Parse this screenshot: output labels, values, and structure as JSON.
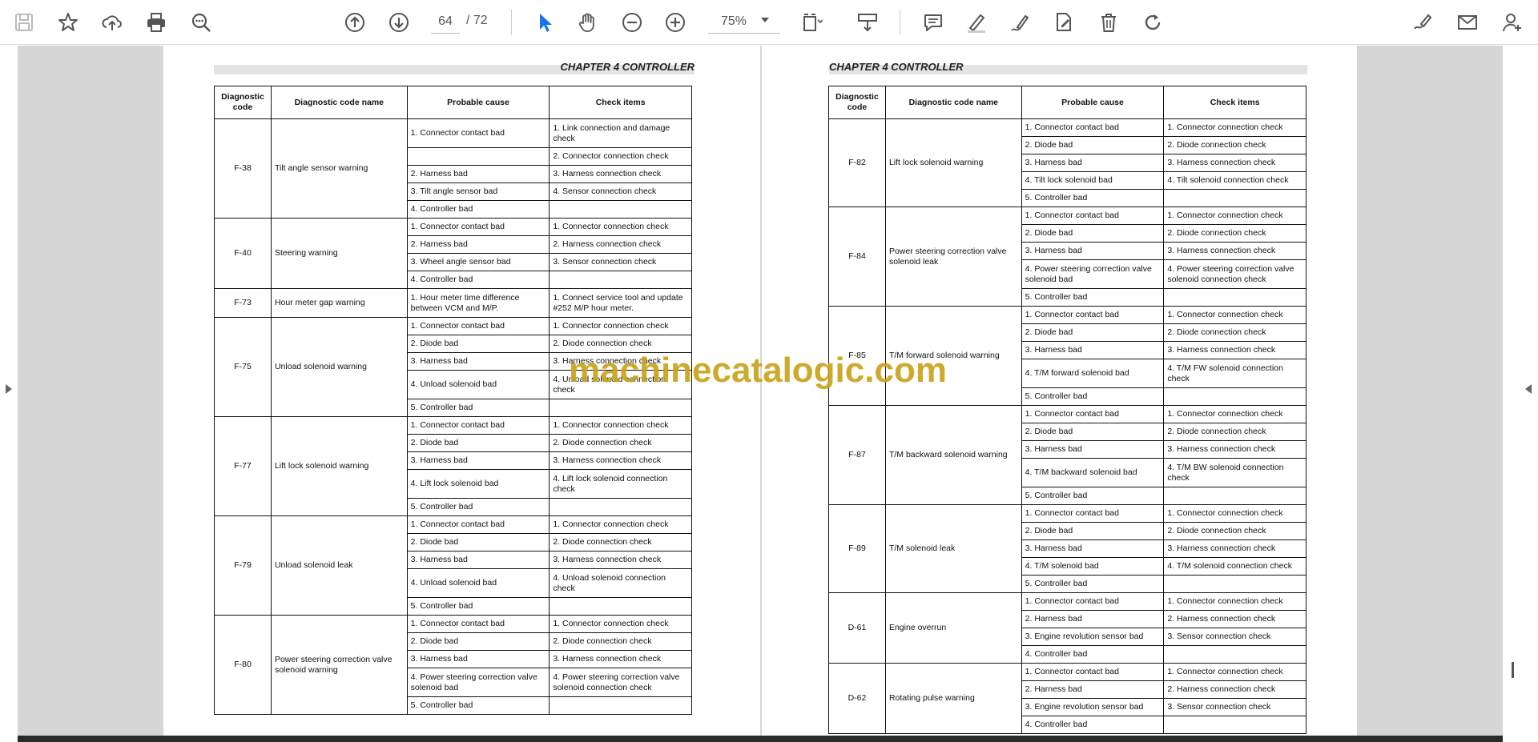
{
  "toolbar": {
    "page_current": "64",
    "page_total": "/ 72",
    "zoom": "75%"
  },
  "watermark": "machinecatalogic.com",
  "left_page": {
    "chapter": "CHAPTER 4 CONTROLLER",
    "headers": [
      "Diagnostic code",
      "Diagnostic code name",
      "Probable cause",
      "Check items"
    ],
    "groups": [
      {
        "code": "F-38",
        "name": "Tilt angle sensor warning",
        "rows": [
          {
            "cause": "1. Connector contact bad",
            "check": "1. Link connection and damage check",
            "tall": true
          },
          {
            "cause": "",
            "check": "2. Connector connection check"
          },
          {
            "cause": "2. Harness bad",
            "check": "3. Harness connection check"
          },
          {
            "cause": "3. Tilt angle sensor bad",
            "check": "4. Sensor connection check"
          },
          {
            "cause": "4. Controller bad",
            "check": ""
          }
        ]
      },
      {
        "code": "F-40",
        "name": "Steering warning",
        "rows": [
          {
            "cause": "1. Connector contact bad",
            "check": "1. Connector connection check"
          },
          {
            "cause": "2. Harness bad",
            "check": "2. Harness connection check"
          },
          {
            "cause": "3. Wheel angle sensor bad",
            "check": "3. Sensor connection check"
          },
          {
            "cause": "4. Controller bad",
            "check": ""
          }
        ]
      },
      {
        "code": "F-73",
        "name": "Hour meter gap warning",
        "rows": [
          {
            "cause": "1. Hour meter time difference between VCM and M/P.",
            "check": "1. Connect service tool and update #252 M/P hour meter.",
            "tall": true
          }
        ]
      },
      {
        "code": "F-75",
        "name": "Unload solenoid warning",
        "rows": [
          {
            "cause": "1. Connector contact bad",
            "check": "1. Connector connection check"
          },
          {
            "cause": "2. Diode bad",
            "check": "2. Diode connection check"
          },
          {
            "cause": "3. Harness bad",
            "check": "3. Harness connection check"
          },
          {
            "cause": "4. Unload solenoid bad",
            "check": "4. Unload solenoid connection check",
            "tall": true
          },
          {
            "cause": "5. Controller bad",
            "check": ""
          }
        ]
      },
      {
        "code": "F-77",
        "name": "Lift lock solenoid warning",
        "rows": [
          {
            "cause": "1. Connector contact bad",
            "check": "1. Connector connection check"
          },
          {
            "cause": "2. Diode bad",
            "check": "2. Diode connection check"
          },
          {
            "cause": "3. Harness bad",
            "check": "3. Harness connection check"
          },
          {
            "cause": "4. Lift lock solenoid bad",
            "check": "4. Lift lock solenoid connection check",
            "tall": true
          },
          {
            "cause": "5. Controller bad",
            "check": ""
          }
        ]
      },
      {
        "code": "F-79",
        "name": "Unload solenoid leak",
        "rows": [
          {
            "cause": "1. Connector contact bad",
            "check": "1. Connector connection check"
          },
          {
            "cause": "2. Diode bad",
            "check": "2. Diode connection check"
          },
          {
            "cause": "3. Harness bad",
            "check": "3. Harness connection check"
          },
          {
            "cause": "4. Unload solenoid bad",
            "check": "4. Unload solenoid connection check",
            "tall": true
          },
          {
            "cause": "5. Controller bad",
            "check": ""
          }
        ]
      },
      {
        "code": "F-80",
        "name": "Power steering correction valve solenoid warning",
        "rows": [
          {
            "cause": "1. Connector contact bad",
            "check": "1. Connector connection check"
          },
          {
            "cause": "2. Diode bad",
            "check": "2. Diode connection check"
          },
          {
            "cause": "3. Harness bad",
            "check": "3. Harness connection check"
          },
          {
            "cause": "4. Power steering correction valve solenoid bad",
            "check": "4. Power steering correction valve solenoid connection check",
            "tall": true
          },
          {
            "cause": "5. Controller bad",
            "check": ""
          }
        ]
      }
    ]
  },
  "right_page": {
    "chapter": "CHAPTER 4 CONTROLLER",
    "headers": [
      "Diagnostic code",
      "Diagnostic code name",
      "Probable cause",
      "Check items"
    ],
    "groups": [
      {
        "code": "F-82",
        "name": "Lift lock solenoid warning",
        "rows": [
          {
            "cause": "1. Connector contact bad",
            "check": "1. Connector connection check"
          },
          {
            "cause": "2. Diode bad",
            "check": "2. Diode connection check"
          },
          {
            "cause": "3. Harness bad",
            "check": "3. Harness connection check"
          },
          {
            "cause": "4. Tilt lock solenoid bad",
            "check": "4. Tilt solenoid connection check"
          },
          {
            "cause": "5. Controller bad",
            "check": ""
          }
        ]
      },
      {
        "code": "F-84",
        "name": "Power steering correction valve solenoid leak",
        "rows": [
          {
            "cause": "1. Connector contact bad",
            "check": "1. Connector connection check"
          },
          {
            "cause": "2. Diode bad",
            "check": "2. Diode connection check"
          },
          {
            "cause": "3. Harness bad",
            "check": "3. Harness connection check"
          },
          {
            "cause": "4. Power steering correction valve solenoid bad",
            "check": "4. Power steering correction valve solenoid connection check",
            "tall": true
          },
          {
            "cause": "5. Controller bad",
            "check": ""
          }
        ]
      },
      {
        "code": "F-85",
        "name": "T/M forward solenoid warning",
        "rows": [
          {
            "cause": "1. Connector contact bad",
            "check": "1. Connector connection check"
          },
          {
            "cause": "2. Diode bad",
            "check": "2. Diode connection check"
          },
          {
            "cause": "3. Harness bad",
            "check": "3. Harness connection check"
          },
          {
            "cause": "4. T/M forward solenoid bad",
            "check": "4. T/M FW solenoid connection check",
            "tall": true
          },
          {
            "cause": "5. Controller bad",
            "check": ""
          }
        ]
      },
      {
        "code": "F-87",
        "name": "T/M backward solenoid warning",
        "rows": [
          {
            "cause": "1. Connector contact bad",
            "check": "1. Connector connection check"
          },
          {
            "cause": "2. Diode bad",
            "check": "2. Diode connection check"
          },
          {
            "cause": "3. Harness bad",
            "check": "3. Harness connection check"
          },
          {
            "cause": "4. T/M backward solenoid bad",
            "check": "4. T/M BW solenoid connection check",
            "tall": true
          },
          {
            "cause": "5. Controller bad",
            "check": ""
          }
        ]
      },
      {
        "code": "F-89",
        "name": "T/M solenoid leak",
        "rows": [
          {
            "cause": "1. Connector contact bad",
            "check": "1. Connector connection check"
          },
          {
            "cause": "2. Diode bad",
            "check": "2. Diode connection check"
          },
          {
            "cause": "3. Harness bad",
            "check": "3. Harness connection check"
          },
          {
            "cause": "4. T/M solenoid bad",
            "check": "4. T/M solenoid connection check"
          },
          {
            "cause": "5. Controller bad",
            "check": ""
          }
        ]
      },
      {
        "code": "D-61",
        "name": "Engine overrun",
        "rows": [
          {
            "cause": "1. Connector contact bad",
            "check": "1. Connector connection check"
          },
          {
            "cause": "2. Harness bad",
            "check": "2. Harness connection check"
          },
          {
            "cause": "3. Engine revolution sensor bad",
            "check": "3. Sensor connection check"
          },
          {
            "cause": "4. Controller bad",
            "check": ""
          }
        ]
      },
      {
        "code": "D-62",
        "name": "Rotating pulse warning",
        "rows": [
          {
            "cause": "1. Connector contact bad",
            "check": "1. Connector connection check"
          },
          {
            "cause": "2. Harness bad",
            "check": "2. Harness connection check"
          },
          {
            "cause": "3. Engine revolution sensor bad",
            "check": "3. Sensor connection check"
          },
          {
            "cause": "4. Controller bad",
            "check": ""
          }
        ]
      }
    ]
  }
}
